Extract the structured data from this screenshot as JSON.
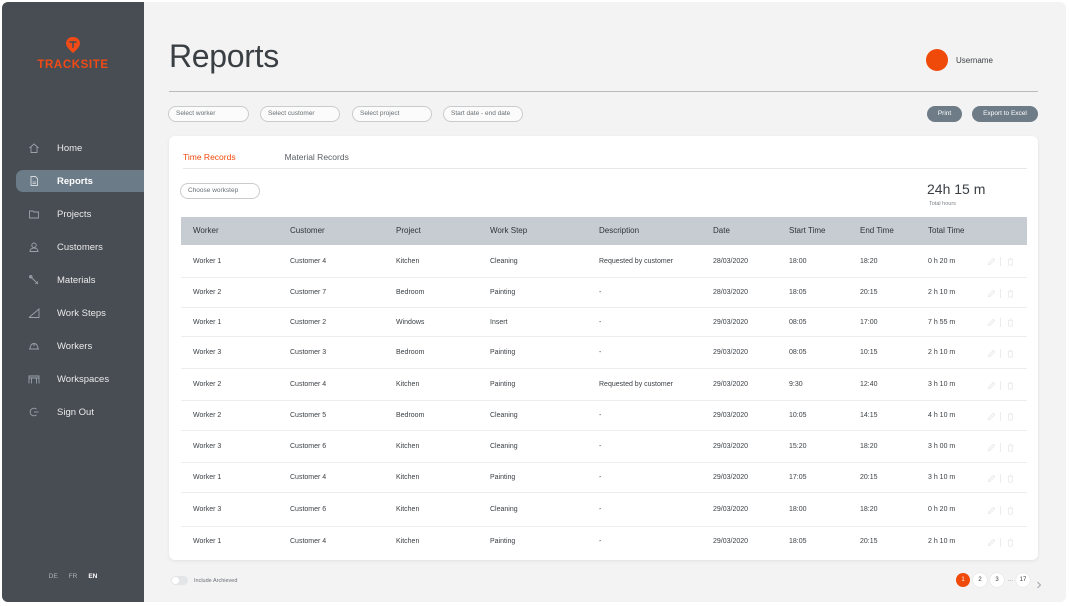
{
  "brand": {
    "name": "TRACKSITE",
    "color": "#f04a16"
  },
  "sidebar": {
    "items": [
      {
        "label": "Home",
        "icon": "home-icon",
        "active": false
      },
      {
        "label": "Reports",
        "icon": "document-icon",
        "active": true
      },
      {
        "label": "Projects",
        "icon": "folder-icon",
        "active": false
      },
      {
        "label": "Customers",
        "icon": "user-icon",
        "active": false
      },
      {
        "label": "Materials",
        "icon": "tools-icon",
        "active": false
      },
      {
        "label": "Work Steps",
        "icon": "stairs-icon",
        "active": false
      },
      {
        "label": "Workers",
        "icon": "helmet-icon",
        "active": false
      },
      {
        "label": "Workspaces",
        "icon": "building-icon",
        "active": false
      },
      {
        "label": "Sign Out",
        "icon": "sign-out-icon",
        "active": false
      }
    ],
    "languages": [
      "DE",
      "FR",
      "EN"
    ],
    "current_language": "EN"
  },
  "header": {
    "title": "Reports",
    "username": "Username",
    "avatar_color": "#f04a0a"
  },
  "filters": {
    "worker": "Select worker",
    "customer": "Select customer",
    "project": "Select project",
    "dates": "Start date - end date"
  },
  "actions": {
    "print": "Print",
    "export": "Export to Excel"
  },
  "tabs": [
    {
      "label": "Time Records",
      "active": true
    },
    {
      "label": "Material Records",
      "active": false
    }
  ],
  "workstep_select": "Choose workstep",
  "total": {
    "value": "24h 15 m",
    "label": "Total hours"
  },
  "table": {
    "columns": [
      "Worker",
      "Customer",
      "Project",
      "Work Step",
      "Description",
      "Date",
      "Start Time",
      "End Time",
      "Total Time"
    ],
    "rows": [
      [
        "Worker 1",
        "Customer 4",
        "Kitchen",
        "Cleaning",
        "Requested by customer",
        "28/03/2020",
        "18:00",
        "18:20",
        "0 h 20 m"
      ],
      [
        "Worker 2",
        "Customer 7",
        "Bedroom",
        "Painting",
        "-",
        "28/03/2020",
        "18:05",
        "20:15",
        "2 h 10 m"
      ],
      [
        "Worker 1",
        "Customer 2",
        "Windows",
        "Insert",
        "-",
        "29/03/2020",
        "08:05",
        "17:00",
        "7 h 55 m"
      ],
      [
        "Worker 3",
        "Customer 3",
        "Bedroom",
        "Painting",
        "-",
        "29/03/2020",
        "08:05",
        "10:15",
        "2 h 10 m"
      ],
      [
        "Worker 2",
        "Customer 4",
        "Kitchen",
        "Painting",
        "Requested by customer",
        "29/03/2020",
        "9:30",
        "12:40",
        "3 h 10 m"
      ],
      [
        "Worker 2",
        "Customer 5",
        "Bedroom",
        "Cleaning",
        "-",
        "29/03/2020",
        "10:05",
        "14:15",
        "4 h 10 m"
      ],
      [
        "Worker 3",
        "Customer 6",
        "Kitchen",
        "Cleaning",
        "-",
        "29/03/2020",
        "15:20",
        "18:20",
        "3 h 00 m"
      ],
      [
        "Worker 1",
        "Customer 4",
        "Kitchen",
        "Painting",
        "-",
        "29/03/2020",
        "17:05",
        "20:15",
        "3 h 10 m"
      ],
      [
        "Worker 3",
        "Customer 6",
        "Kitchen",
        "Cleaning",
        "-",
        "29/03/2020",
        "18:00",
        "18:20",
        "0 h 20 m"
      ],
      [
        "Worker 1",
        "Customer 4",
        "Kitchen",
        "Painting",
        "-",
        "29/03/2020",
        "18:05",
        "20:15",
        "2 h 10 m"
      ]
    ],
    "row_action_icons": [
      "edit-icon",
      "trash-icon"
    ]
  },
  "footer": {
    "toggle_label": "Include Archieved",
    "toggle_on": false
  },
  "pagination": {
    "pages": [
      "1",
      "2",
      "3"
    ],
    "ellipsis": "...",
    "last": "17",
    "current": "1"
  }
}
